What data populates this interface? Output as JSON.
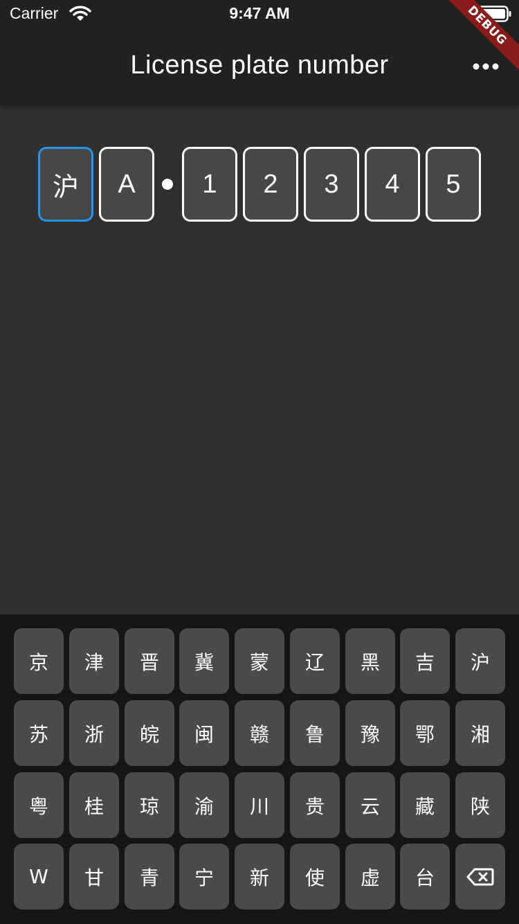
{
  "status_bar": {
    "carrier": "Carrier",
    "time": "9:47 AM"
  },
  "app_bar": {
    "title": "License plate number",
    "more_icon": "more-horiz-icon"
  },
  "debug_banner": "DEBUG",
  "plate": {
    "cells": [
      "沪",
      "A",
      "1",
      "2",
      "3",
      "4",
      "5"
    ],
    "active_index": 0,
    "active_color": "#2196f3"
  },
  "keyboard": {
    "rows": [
      [
        "京",
        "津",
        "晋",
        "冀",
        "蒙",
        "辽",
        "黑",
        "吉",
        "沪"
      ],
      [
        "苏",
        "浙",
        "皖",
        "闽",
        "赣",
        "鲁",
        "豫",
        "鄂",
        "湘"
      ],
      [
        "粤",
        "桂",
        "琼",
        "渝",
        "川",
        "贵",
        "云",
        "藏",
        "陕"
      ],
      [
        "W",
        "甘",
        "青",
        "宁",
        "新",
        "使",
        "虚",
        "台"
      ]
    ],
    "delete_icon": "backspace-icon"
  }
}
